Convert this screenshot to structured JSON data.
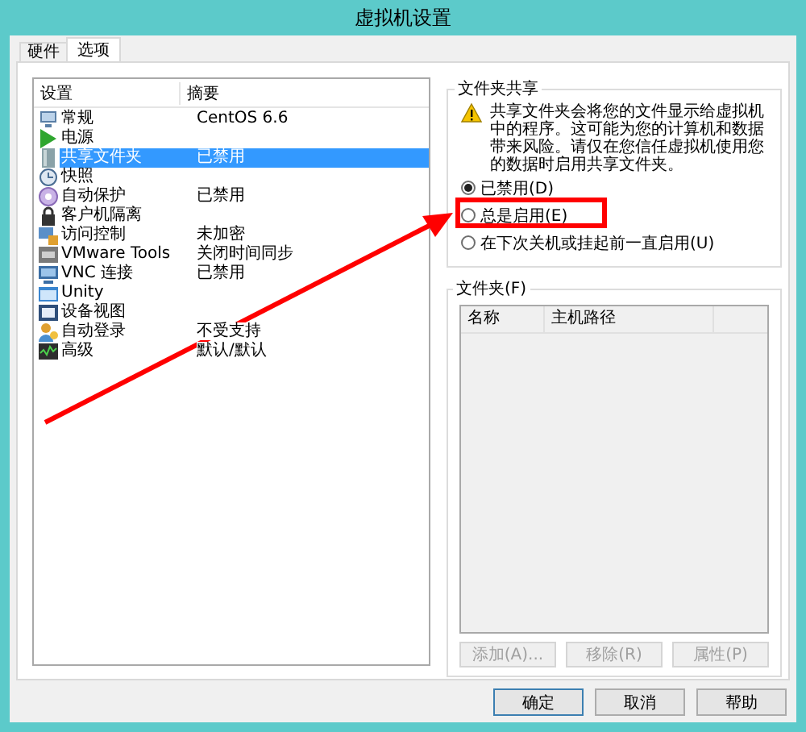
{
  "window": {
    "title": "虚拟机设置"
  },
  "tabs": [
    {
      "label": "硬件",
      "selected": false
    },
    {
      "label": "选项",
      "selected": true
    }
  ],
  "settings_list": {
    "columns": [
      "设置",
      "摘要"
    ],
    "rows": [
      {
        "name": "常规",
        "summary": "CentOS 6.6",
        "selected": false
      },
      {
        "name": "电源",
        "summary": "",
        "selected": false
      },
      {
        "name": "共享文件夹",
        "summary": "已禁用",
        "selected": true
      },
      {
        "name": "快照",
        "summary": "",
        "selected": false
      },
      {
        "name": "自动保护",
        "summary": "已禁用",
        "selected": false
      },
      {
        "name": "客户机隔离",
        "summary": "",
        "selected": false
      },
      {
        "name": "访问控制",
        "summary": "未加密",
        "selected": false
      },
      {
        "name": "VMware Tools",
        "summary": "关闭时间同步",
        "selected": false
      },
      {
        "name": "VNC 连接",
        "summary": "已禁用",
        "selected": false
      },
      {
        "name": "Unity",
        "summary": "",
        "selected": false
      },
      {
        "name": "设备视图",
        "summary": "",
        "selected": false
      },
      {
        "name": "自动登录",
        "summary": "不受支持",
        "selected": false
      },
      {
        "name": "高级",
        "summary": "默认/默认",
        "selected": false
      }
    ]
  },
  "folder_sharing": {
    "title": "文件夹共享",
    "warning": "共享文件夹会将您的文件显示给虚拟机中的程序。这可能为您的计算机和数据带来风险。请仅在您信任虚拟机使用您的数据时启用共享文件夹。",
    "options": [
      {
        "label": "已禁用(D)",
        "selected": true
      },
      {
        "label": "总是启用(E)",
        "selected": false
      },
      {
        "label": "在下次关机或挂起前一直启用(U)",
        "selected": false
      }
    ]
  },
  "folders": {
    "title": "文件夹(F)",
    "columns": [
      "名称",
      "主机路径"
    ],
    "buttons": [
      {
        "label": "添加(A)...",
        "disabled": true
      },
      {
        "label": "移除(R)",
        "disabled": true
      },
      {
        "label": "属性(P)",
        "disabled": true
      }
    ]
  },
  "buttons": [
    {
      "label": "确定",
      "default": true
    },
    {
      "label": "取消",
      "default": false
    },
    {
      "label": "帮助",
      "default": false
    }
  ],
  "annotations": {
    "arrow": true,
    "highlight_box": true
  }
}
